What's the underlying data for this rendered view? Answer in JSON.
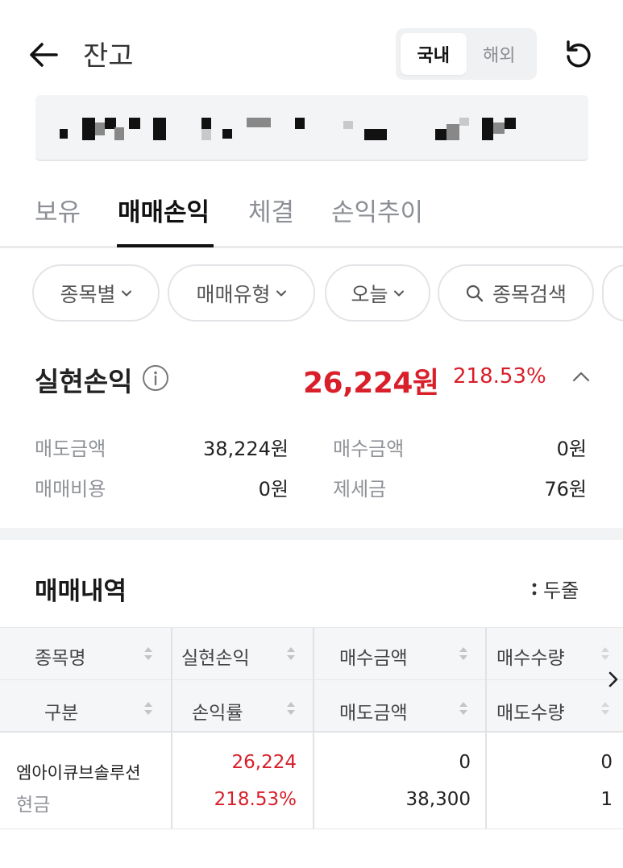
{
  "header": {
    "title": "잔고",
    "segment": {
      "options": [
        "국내",
        "해외"
      ],
      "selected": "국내"
    }
  },
  "tabs": [
    {
      "label": "보유",
      "active": false
    },
    {
      "label": "매매손익",
      "active": true
    },
    {
      "label": "체결",
      "active": false
    },
    {
      "label": "손익추이",
      "active": false
    }
  ],
  "filters": {
    "by_stock": "종목별",
    "trade_type": "매매유형",
    "period": "오늘",
    "search_label": "종목검색"
  },
  "realized": {
    "label": "실현손익",
    "amount": "26,224원",
    "rate": "218.53%",
    "sell_amount_label": "매도금액",
    "sell_amount": "38,224원",
    "buy_amount_label": "매수금액",
    "buy_amount": "0원",
    "trade_cost_label": "매매비용",
    "trade_cost": "0원",
    "tax_label": "제세금",
    "tax": "76원"
  },
  "history": {
    "title": "매매내역",
    "view_toggle": "두줄",
    "columns_row1": [
      "종목명",
      "실현손익",
      "매수금액",
      "매수수량"
    ],
    "columns_row2": [
      "구분",
      "손익률",
      "매도금액",
      "매도수량"
    ],
    "rows": [
      {
        "name": "엠아이큐브솔루션",
        "type": "현금",
        "pnl": "26,224",
        "pnl_rate": "218.53%",
        "buy_amount": "0",
        "sell_amount": "38,300",
        "buy_qty": "0",
        "sell_qty": "1"
      }
    ]
  },
  "colors": {
    "profit": "#d81f2a",
    "text": "#222222",
    "muted": "#8f9297"
  },
  "icons": [
    "back-arrow-icon",
    "refresh-icon",
    "chevron-down-icon",
    "search-icon",
    "info-icon",
    "chevron-up-icon",
    "sort-icon",
    "chevron-right-icon"
  ]
}
